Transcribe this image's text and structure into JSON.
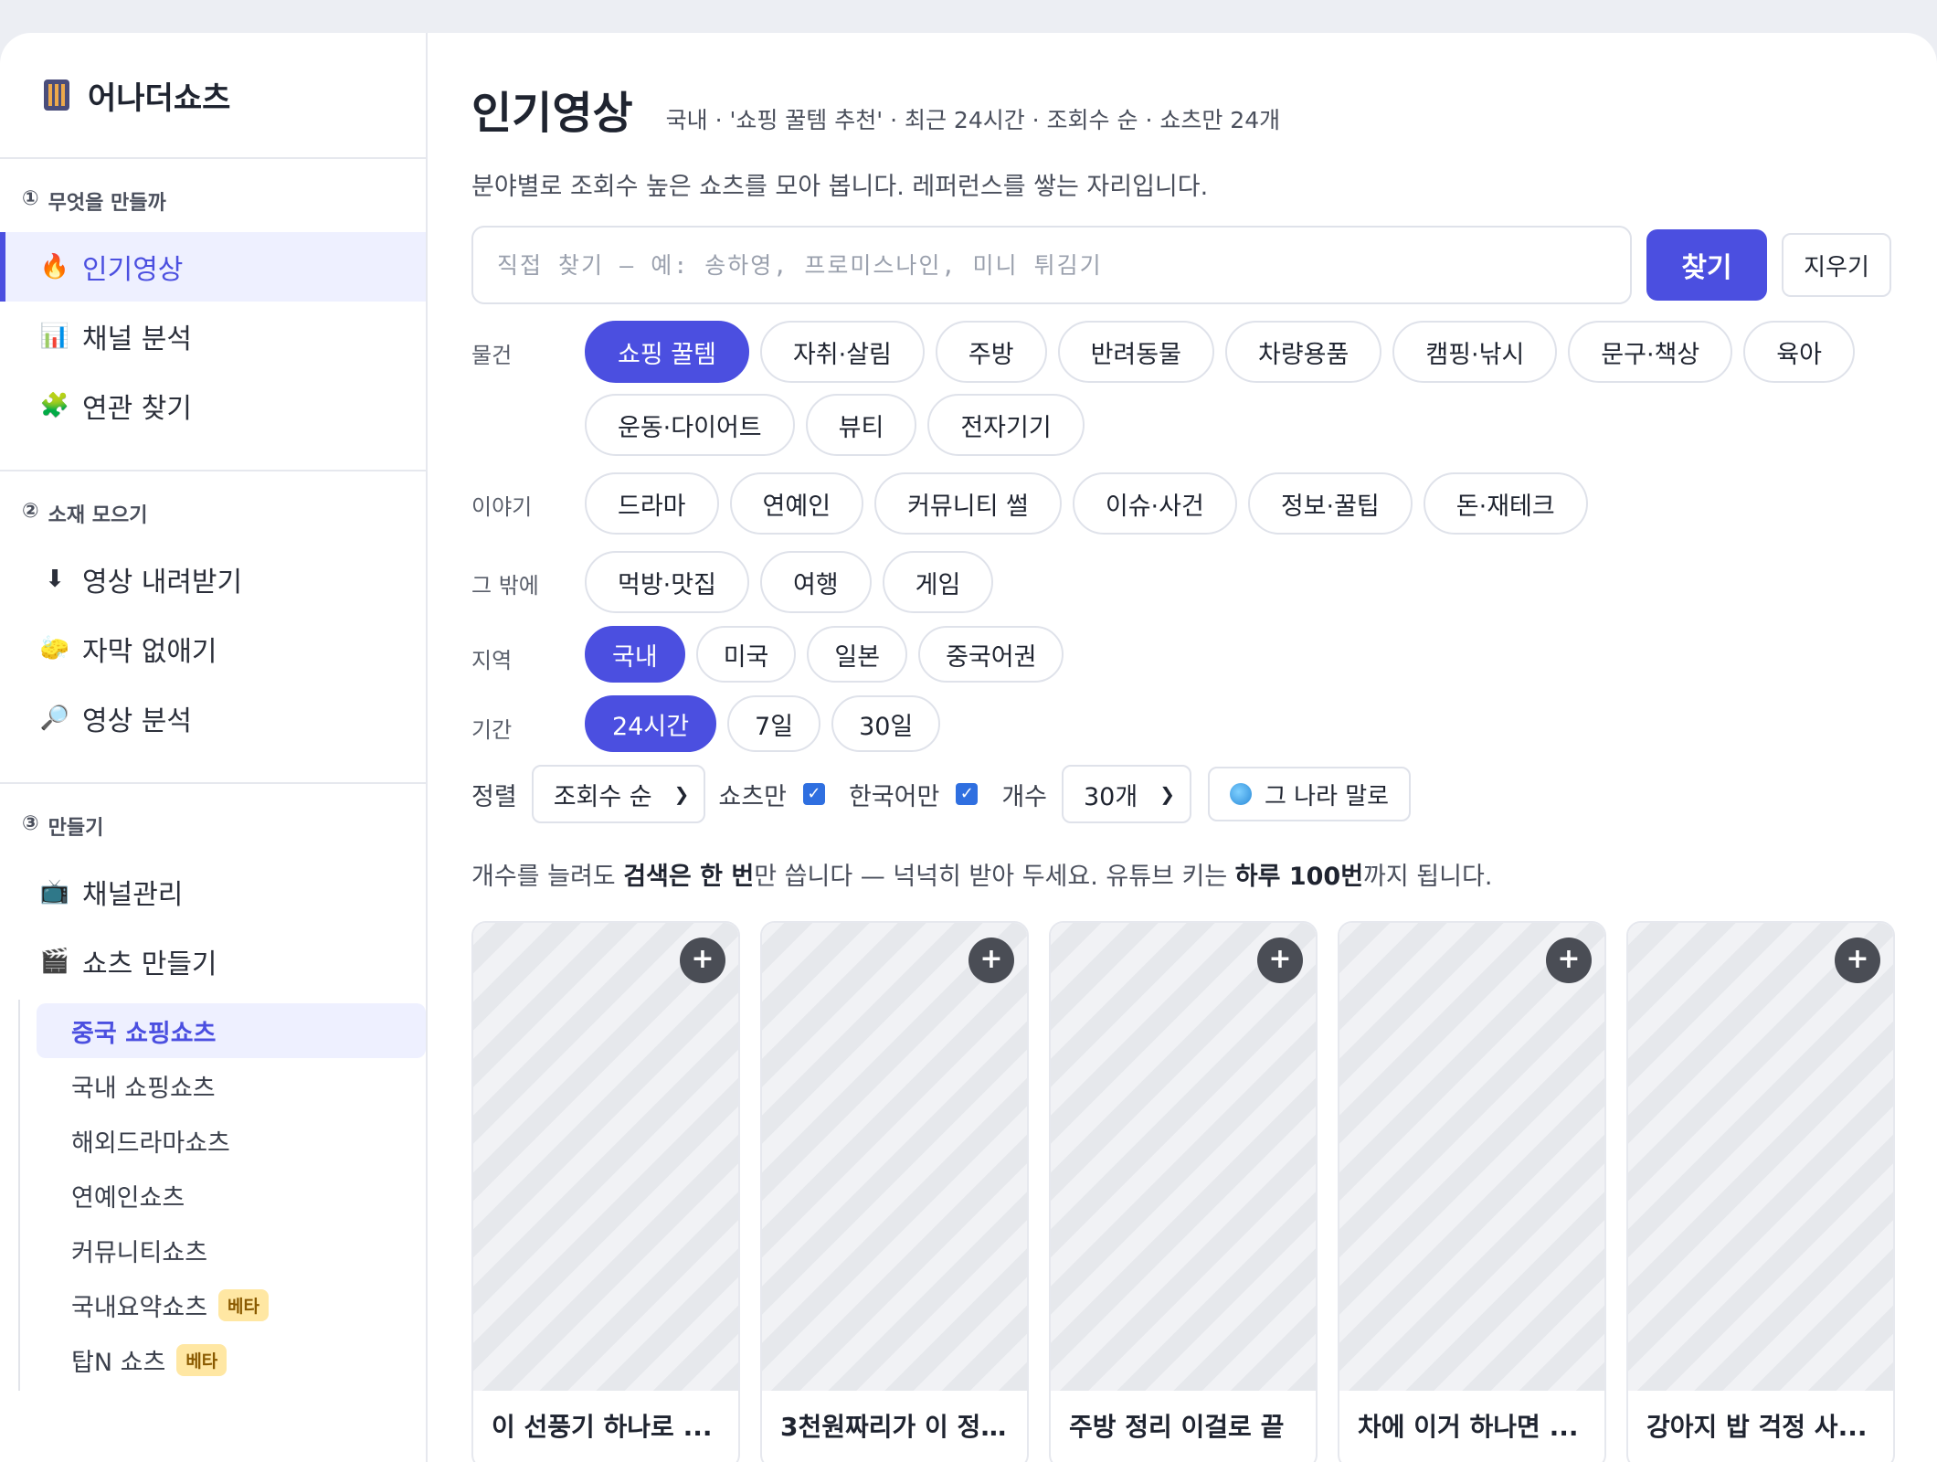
{
  "brand": {
    "title": "어나더쇼츠",
    "icon": "calculator-icon"
  },
  "sidebar": {
    "sections": [
      {
        "num": "①",
        "title": "무엇을 만들까",
        "items": [
          {
            "icon": "🔥",
            "label": "인기영상",
            "active": true
          },
          {
            "icon": "📊",
            "label": "채널 분석"
          },
          {
            "icon": "🧩",
            "label": "연관 찾기"
          }
        ]
      },
      {
        "num": "②",
        "title": "소재 모으기",
        "items": [
          {
            "icon": "⬇",
            "label": "영상 내려받기"
          },
          {
            "icon": "🧽",
            "label": "자막 없애기"
          },
          {
            "icon": "🔎",
            "label": "영상 분석"
          }
        ]
      },
      {
        "num": "③",
        "title": "만들기",
        "items": [
          {
            "icon": "📺",
            "label": "채널관리"
          },
          {
            "icon": "🎬",
            "label": "쇼츠 만들기"
          }
        ],
        "sub": [
          {
            "label": "중국 쇼핑쇼츠",
            "active": true
          },
          {
            "label": "국내 쇼핑쇼츠"
          },
          {
            "label": "해외드라마쇼츠"
          },
          {
            "label": "연예인쇼츠"
          },
          {
            "label": "커뮤니티쇼츠"
          },
          {
            "label": "국내요약쇼츠",
            "badge": "베타"
          },
          {
            "label": "탑N 쇼츠",
            "badge": "베타"
          }
        ]
      }
    ]
  },
  "main": {
    "title": "인기영상",
    "meta": "국내 · '쇼핑 꿀템 추천' · 최근 24시간 · 조회수 순 · 쇼츠만 24개",
    "desc": "분야별로 조회수 높은 쇼츠를 모아 봅니다. 레퍼런스를 쌓는 자리입니다.",
    "search": {
      "placeholder": "직접 찾기 — 예: 송하영, 프로미스나인, 미니 튀김기",
      "value": ""
    },
    "search_button": "찾기",
    "clear_button": "지우기",
    "filters": [
      {
        "label": "물건",
        "chips": [
          "쇼핑 꿀템",
          "자취·살림",
          "주방",
          "반려동물",
          "차량용품",
          "캠핑·낚시",
          "문구·책상",
          "육아",
          "운동·다이어트",
          "뷰티",
          "전자기기"
        ],
        "selected": "쇼핑 꿀템"
      },
      {
        "label": "이야기",
        "chips": [
          "드라마",
          "연예인",
          "커뮤니티 썰",
          "이슈·사건",
          "정보·꿀팁",
          "돈·재테크"
        ],
        "selected": ""
      },
      {
        "label": "그 밖에",
        "chips": [
          "먹방·맛집",
          "여행",
          "게임"
        ],
        "selected": ""
      },
      {
        "label": "지역",
        "chips": [
          "국내",
          "미국",
          "일본",
          "중국어권"
        ],
        "selected": "국내",
        "small": true
      },
      {
        "label": "기간",
        "chips": [
          "24시간",
          "7일",
          "30일"
        ],
        "selected": "24시간",
        "small": true
      }
    ],
    "sort": {
      "label": "정렬",
      "value": "조회수 순",
      "shorts_only_label": "쇼츠만",
      "shorts_only": true,
      "korean_only_label": "한국어만",
      "korean_only": true,
      "count_label": "개수",
      "count_value": "30개",
      "lang_button": "그 나라 말로"
    },
    "hint": {
      "p1": "개수를 늘려도 ",
      "b1": "검색은 한 번",
      "p2": "만 씁니다 — 넉넉히 받아 두세요. 유튜브 키는 ",
      "b2": "하루 100번",
      "p3": "까지 됩니다."
    },
    "cards": [
      {
        "title": "이 선풍기 하나로 ..."
      },
      {
        "title": "3천원짜리가 이 정..."
      },
      {
        "title": "주방 정리 이걸로 끝"
      },
      {
        "title": "차에 이거 하나면 ..."
      },
      {
        "title": "강아지 밥 걱정 사..."
      }
    ]
  }
}
